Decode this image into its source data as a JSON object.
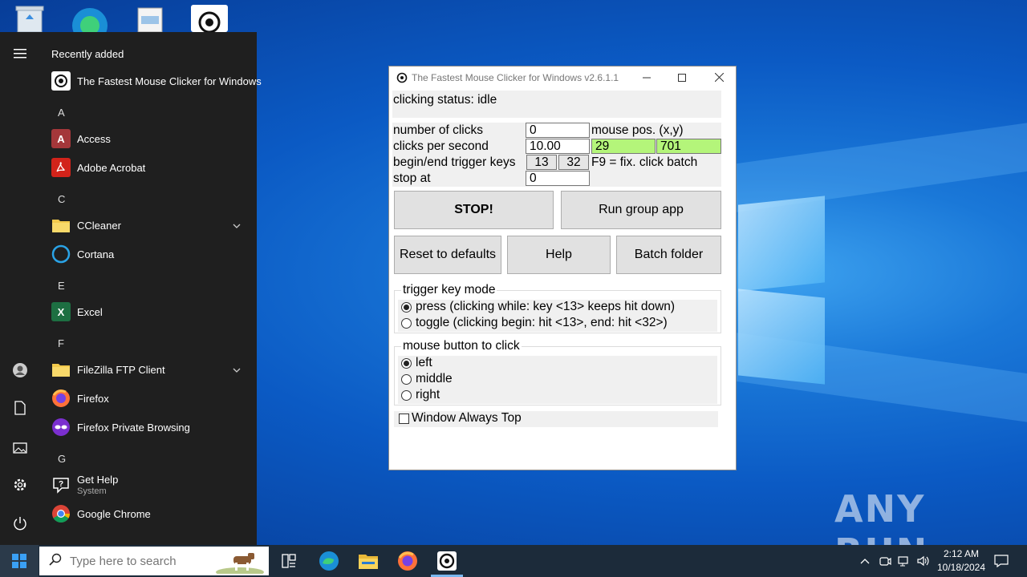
{
  "desktop": {
    "watermark": "ANY RUN"
  },
  "start_menu": {
    "recently_added_title": "Recently added",
    "recent_items": [
      {
        "label": "The Fastest Mouse Clicker for Windows",
        "icon": "mouse-clicker-icon"
      }
    ],
    "groups": [
      {
        "letter": "A",
        "items": [
          {
            "label": "Access",
            "icon": "access-icon",
            "color": "#a4373a"
          },
          {
            "label": "Adobe Acrobat",
            "icon": "acrobat-icon",
            "color": "#d2231a"
          }
        ]
      },
      {
        "letter": "C",
        "items": [
          {
            "label": "CCleaner",
            "icon": "folder-icon",
            "color": "#f2c94c",
            "expandable": true
          },
          {
            "label": "Cortana",
            "icon": "cortana-icon",
            "color": "#2aa3e6"
          }
        ]
      },
      {
        "letter": "E",
        "items": [
          {
            "label": "Excel",
            "icon": "excel-icon",
            "color": "#1d6f42"
          }
        ]
      },
      {
        "letter": "F",
        "items": [
          {
            "label": "FileZilla FTP Client",
            "icon": "folder-icon",
            "color": "#f2c94c",
            "expandable": true
          },
          {
            "label": "Firefox",
            "icon": "firefox-icon",
            "color": "#ff7139"
          },
          {
            "label": "Firefox Private Browsing",
            "icon": "firefox-private-icon",
            "color": "#7b2fcf"
          }
        ]
      },
      {
        "letter": "G",
        "items": [
          {
            "label": "Get Help",
            "sub": "System",
            "icon": "get-help-icon",
            "color": "#ffffff"
          },
          {
            "label": "Google Chrome",
            "icon": "chrome-icon",
            "color": "#4285f4"
          }
        ]
      }
    ],
    "rail": [
      "hamburger-menu-icon",
      "user-icon",
      "documents-icon",
      "pictures-icon",
      "settings-icon",
      "power-icon"
    ]
  },
  "window": {
    "title": "The Fastest Mouse Clicker for Windows v2.6.1.1",
    "status": "clicking status: idle",
    "labels": {
      "number_of_clicks": "number of clicks",
      "clicks_per_second": "clicks per second",
      "trigger_keys": "begin/end trigger keys",
      "stop_at": "stop at",
      "mouse_pos": "mouse pos. (x,y)",
      "f9_hint": "F9 = fix. click batch"
    },
    "values": {
      "number_of_clicks": "0",
      "clicks_per_second": "10.00",
      "begin_key": "13",
      "end_key": "32",
      "stop_at": "0",
      "mouse_x": "29",
      "mouse_y": "701"
    },
    "buttons": {
      "stop": "STOP!",
      "run_group": "Run group app",
      "reset": "Reset to defaults",
      "help": "Help",
      "batch_folder": "Batch folder"
    },
    "trigger_mode": {
      "title": "trigger key mode",
      "options": [
        {
          "label": "press (clicking while: key <13> keeps hit down)",
          "selected": true
        },
        {
          "label": "toggle (clicking begin: hit <13>, end: hit <32>)",
          "selected": false
        }
      ]
    },
    "mouse_button": {
      "title": "mouse button to click",
      "options": [
        {
          "label": "left",
          "selected": true
        },
        {
          "label": "middle",
          "selected": false
        },
        {
          "label": "right",
          "selected": false
        }
      ]
    },
    "always_top": {
      "label": "Window Always Top",
      "checked": false
    },
    "colors": {
      "mouse_pos_bg": "#b4f57a"
    }
  },
  "taskbar": {
    "search_placeholder": "Type here to search",
    "pinned": [
      "task-view-icon",
      "edge-icon",
      "file-explorer-icon",
      "firefox-icon",
      "mouse-clicker-icon"
    ],
    "clock_time": "2:12 AM",
    "clock_date": "10/18/2024"
  }
}
